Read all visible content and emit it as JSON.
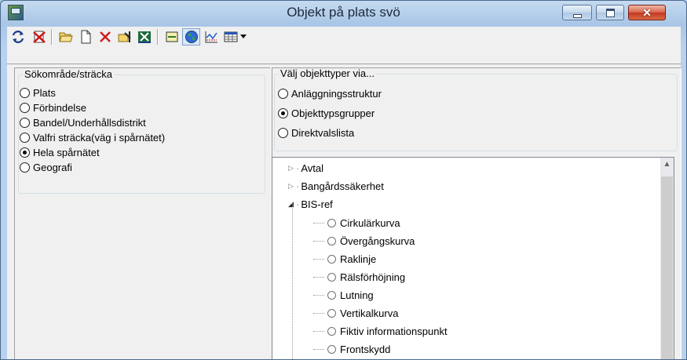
{
  "window": {
    "title": "Objekt på plats svö"
  },
  "toolbar": {
    "buttons": [
      {
        "icon": "refresh-icon"
      },
      {
        "icon": "delete-red-icon"
      },
      {
        "icon": "open-folder-icon"
      },
      {
        "icon": "new-document-icon"
      },
      {
        "icon": "delete-x-icon"
      },
      {
        "icon": "edit-select-icon"
      },
      {
        "icon": "excel-export-icon"
      },
      {
        "icon": "track-icon"
      },
      {
        "icon": "globe-icon",
        "active": true
      },
      {
        "icon": "chart-icon"
      },
      {
        "icon": "table-icon",
        "has_dropdown": true
      }
    ]
  },
  "sokomrade": {
    "legend": "Sökområde/sträcka",
    "options": [
      {
        "label": "Plats",
        "checked": false
      },
      {
        "label": "Förbindelse",
        "checked": false
      },
      {
        "label": "Bandel/Underhållsdistrikt",
        "checked": false
      },
      {
        "label": "Valfri sträcka(väg i spårnätet)",
        "checked": false
      },
      {
        "label": "Hela spårnätet",
        "checked": true
      },
      {
        "label": "Geografi",
        "checked": false
      }
    ]
  },
  "objekttyper": {
    "legend": "Välj objekttyper via...",
    "options": [
      {
        "label": "Anläggningsstruktur",
        "checked": false
      },
      {
        "label": "Objekttypsgrupper",
        "checked": true
      },
      {
        "label": "Direktvalslista",
        "checked": false
      }
    ]
  },
  "tree": {
    "groups": [
      {
        "label": "Avtal",
        "expanded": false
      },
      {
        "label": "Bangårdssäkerhet",
        "expanded": false
      },
      {
        "label": "BIS-ref",
        "expanded": true
      }
    ],
    "children": [
      "Cirkulärkurva",
      "Övergångskurva",
      "Raklinje",
      "Rälsförhöjning",
      "Lutning",
      "Vertikalkurva",
      "Fiktiv informationspunkt",
      "Frontskydd"
    ]
  }
}
